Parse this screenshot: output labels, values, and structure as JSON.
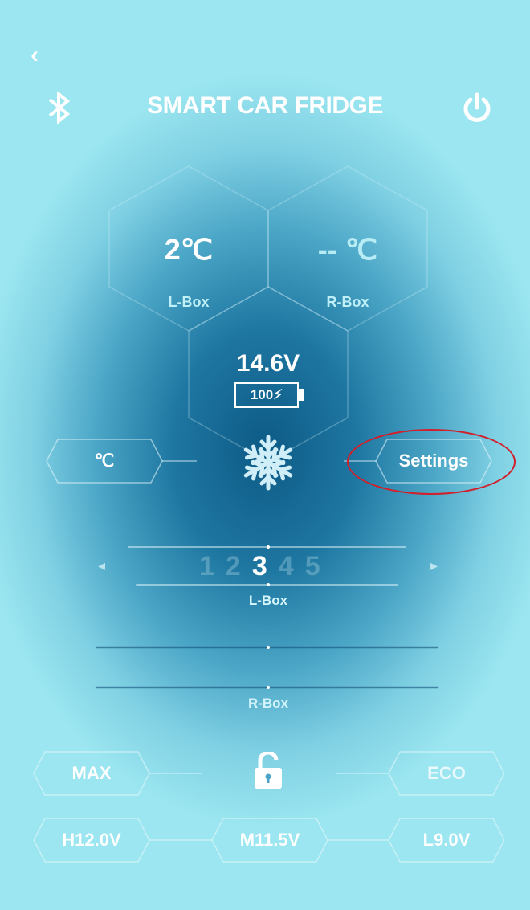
{
  "header": {
    "title": "SMART CAR FRIDGE",
    "back_icon": "chevron-left",
    "bluetooth_icon": "bluetooth",
    "power_icon": "power"
  },
  "boxes": {
    "left": {
      "temp": "2℃",
      "label": "L-Box"
    },
    "right": {
      "temp": "-- ℃",
      "label": "R-Box"
    }
  },
  "battery": {
    "voltage": "14.6V",
    "percent": "100"
  },
  "controls": {
    "unit_button": "℃",
    "snowflake_icon": "snowflake",
    "settings_button": "Settings"
  },
  "level_selector": {
    "levels": [
      "1",
      "2",
      "3",
      "4",
      "5"
    ],
    "selected": "3",
    "label_left": "L-Box",
    "label_right": "R-Box"
  },
  "modes": {
    "max": "MAX",
    "eco": "ECO",
    "lock_icon": "lock-open"
  },
  "voltage_protection": {
    "high": "H12.0V",
    "mid": "M11.5V",
    "low": "L9.0V"
  },
  "colors": {
    "accent": "#ffffff",
    "highlight_oval": "#d21f2a",
    "label": "#bff0f7"
  }
}
